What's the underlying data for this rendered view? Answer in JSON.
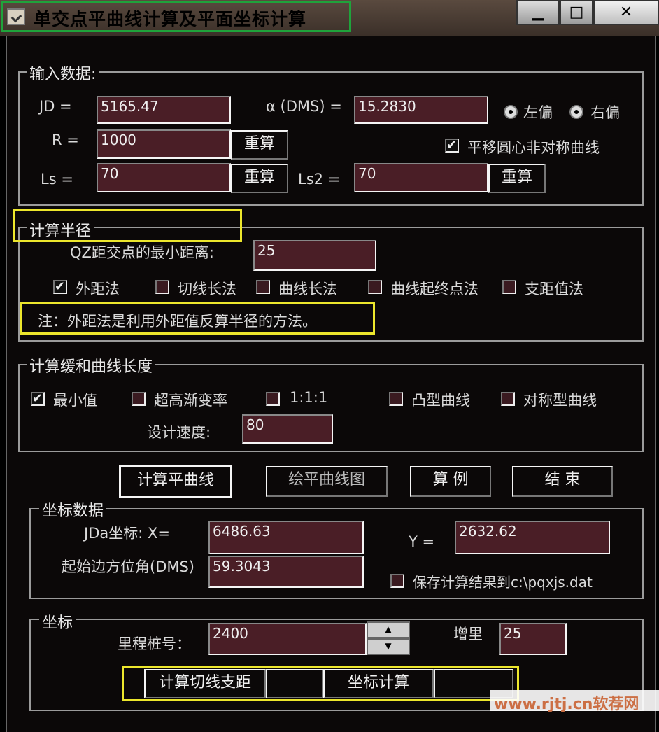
{
  "window": {
    "title": "单交点平曲线计算及平面坐标计算",
    "minimize": "▁",
    "maximize": "□",
    "close": "✕"
  },
  "input": {
    "legend": "输入数据:",
    "jd_label": "JD =",
    "jd_value": "5165.47",
    "alpha_label": "α (DMS) =",
    "alpha_value": "15.2830",
    "left_label": "左偏",
    "right_label": "右偏",
    "r_label": "R =",
    "r_value": "1000",
    "recalc_label": "重算",
    "translate_label": "平移圆心非对称曲线",
    "ls_label": "Ls =",
    "ls_value": "70",
    "ls2_label": "Ls2 =",
    "ls2_value": "70"
  },
  "radius": {
    "legend": "计算半径",
    "qz_label": "QZ距交点的最小距离:",
    "qz_value": "25",
    "options": [
      "外距法",
      "切线长法",
      "曲线长法",
      "曲线起终点法",
      "支距值法"
    ],
    "note": "注：外距法是利用外距值反算半径的方法。"
  },
  "transition": {
    "legend": "计算缓和曲线长度",
    "options": [
      "最小值",
      "超高渐变率",
      "1:1:1",
      "凸型曲线",
      "对称型曲线"
    ],
    "speed_label": "设计速度:",
    "speed_value": "80"
  },
  "actions": {
    "calc": "计算平曲线",
    "draw": "绘平曲线图",
    "example": "算 例",
    "end": "结 束"
  },
  "coords": {
    "legend": "坐标数据",
    "jda_label": "JDa坐标:  X=",
    "x_value": "6486.63",
    "y_label": "Y =",
    "y_value": "2632.62",
    "azimuth_label": "起始边方位角(DMS)",
    "azimuth_value": "59.3043",
    "save_label": "保存计算结果到c:\\pqxjs.dat"
  },
  "coord": {
    "legend": "坐标",
    "station_label": "里程桩号：",
    "station_value": "2400",
    "increment_label": "增里",
    "increment_value": "25",
    "tangent_btn": "计算切线支距",
    "coord_btn": "坐标计算"
  },
  "watermark": "www.rjtj.cn软荐网"
}
